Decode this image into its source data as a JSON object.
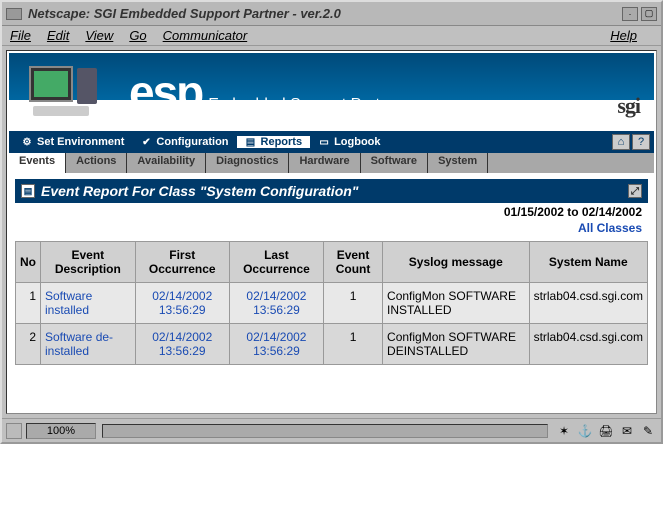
{
  "window": {
    "title": "Netscape: SGI Embedded Support Partner - ver.2.0"
  },
  "menubar": {
    "file": "File",
    "edit": "Edit",
    "view": "View",
    "go": "Go",
    "communicator": "Communicator",
    "help": "Help"
  },
  "banner": {
    "logo": "esp",
    "subtitle": "Embedded Support Partner",
    "brand": "sgi"
  },
  "nav1": {
    "set_env": "Set Environment",
    "config": "Configuration",
    "reports": "Reports",
    "logbook": "Logbook"
  },
  "nav2": {
    "events": "Events",
    "actions": "Actions",
    "availability": "Availability",
    "diagnostics": "Diagnostics",
    "hardware": "Hardware",
    "software": "Software",
    "system": "System"
  },
  "report": {
    "title": "Event Report For Class \"System Configuration\"",
    "date_range": "01/15/2002 to 02/14/2002",
    "all_classes": "All Classes",
    "columns": {
      "no": "No",
      "desc": "Event Description",
      "first": "First Occurrence",
      "last": "Last Occurrence",
      "count": "Event Count",
      "syslog": "Syslog message",
      "system": "System Name"
    },
    "rows": [
      {
        "no": "1",
        "desc": "Software installed",
        "first": "02/14/2002 13:56:29",
        "last": "02/14/2002 13:56:29",
        "count": "1",
        "syslog": "ConfigMon SOFTWARE INSTALLED",
        "system": "strlab04.csd.sgi.com"
      },
      {
        "no": "2",
        "desc": "Software de-installed",
        "first": "02/14/2002 13:56:29",
        "last": "02/14/2002 13:56:29",
        "count": "1",
        "syslog": "ConfigMon SOFTWARE DEINSTALLED",
        "system": "strlab04.csd.sgi.com"
      }
    ]
  },
  "statusbar": {
    "zoom": "100%"
  }
}
